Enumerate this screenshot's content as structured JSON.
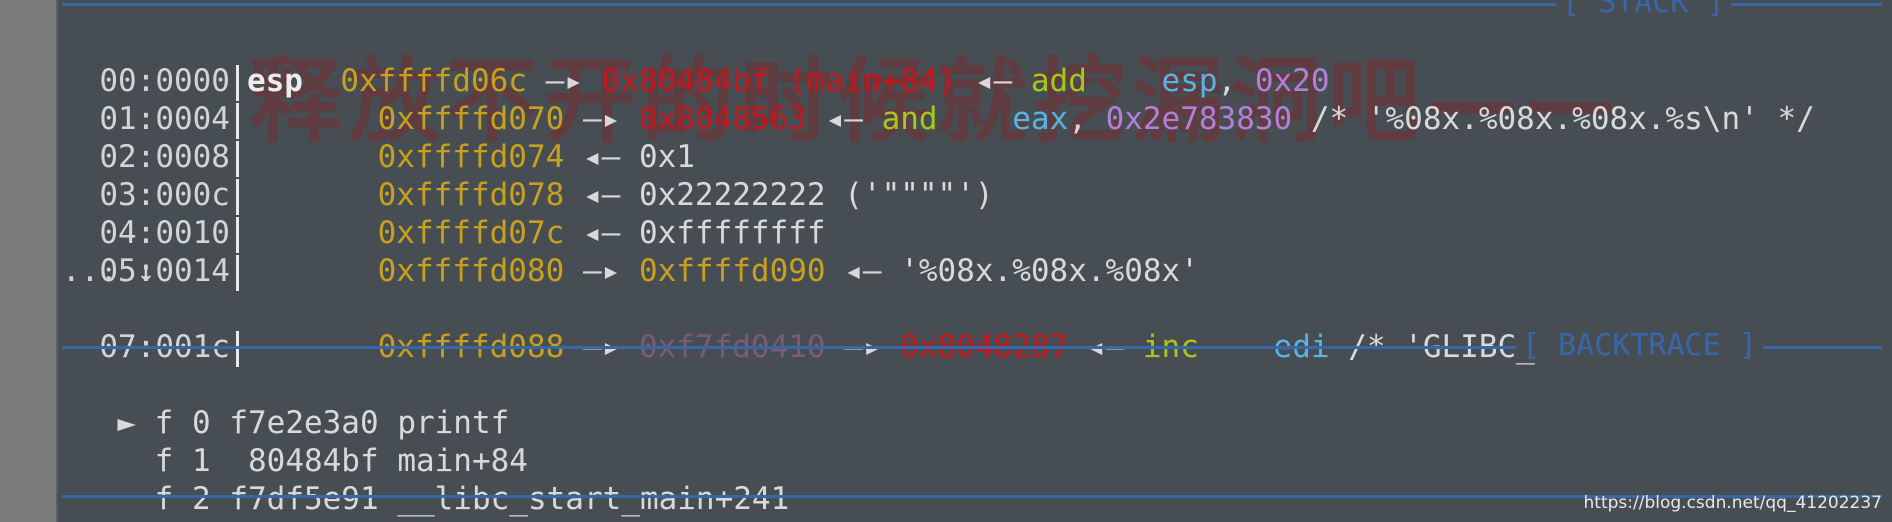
{
  "stack_title": "[ STACK ]",
  "backtrace_title": "[ BACKTRACE ]",
  "watermark": "释放不开的时候就挖漏洞吧——",
  "stack": [
    {
      "idx": "00:0000",
      "reg": "esp",
      "addr": "0xffffd06c",
      "a1": " —▸ ",
      "v1": "0x80484bf (main+84)",
      "a2": " ◂— ",
      "op": "add",
      "args_a": "esp",
      "sep": ", ",
      "args_b": "0x20",
      "tail": ""
    },
    {
      "idx": "01:0004",
      "reg": "",
      "addr": "0xffffd070",
      "a1": " —▸ ",
      "v1": "0x8048563",
      "a2": " ◂— ",
      "op": "and",
      "args_a": "eax",
      "sep": ", ",
      "args_b": "0x2e783830",
      "tail": " /* '%08x.%08x.%08x.%s\\n' */"
    },
    {
      "idx": "02:0008",
      "reg": "",
      "addr": "0xffffd074",
      "a1": " ◂— ",
      "v1": "0x1"
    },
    {
      "idx": "03:000c",
      "reg": "",
      "addr": "0xffffd078",
      "a1": " ◂— ",
      "v1": "0x22222222 ('\"\"\"\"')"
    },
    {
      "idx": "04:0010",
      "reg": "",
      "addr": "0xffffd07c",
      "a1": " ◂— ",
      "v1": "0xffffffff"
    },
    {
      "idx": "05:0014",
      "reg": "",
      "addr": "0xffffd080",
      "a1": " —▸ ",
      "v1": "0xffffd090",
      "a2": " ◂— ",
      "v2": "'%08x.%08x.%08x'"
    },
    {
      "idx": "07:001c",
      "reg": "",
      "addr": "0xffffd088",
      "a1": " —▸ ",
      "v1": "0xf7fd0410",
      "a2": " —▸ ",
      "v2": "0x8048287",
      "a3": " ◂— ",
      "op": "inc",
      "args_a": "edi",
      "tail": " /* 'GLIBC_2.0' */"
    }
  ],
  "ellipsis": "... ↓",
  "backtrace": [
    {
      "marker": "► ",
      "frame": "f 0",
      "addr": "f7e2e3a0",
      "sym": "printf"
    },
    {
      "marker": "  ",
      "frame": "f 1",
      "addr": " 80484bf",
      "sym": "main+84"
    },
    {
      "marker": "  ",
      "frame": "f 2",
      "addr": "f7df5e91",
      "sym": "__libc_start_main+241"
    }
  ],
  "url": "https://blog.csdn.net/qq_41202237"
}
